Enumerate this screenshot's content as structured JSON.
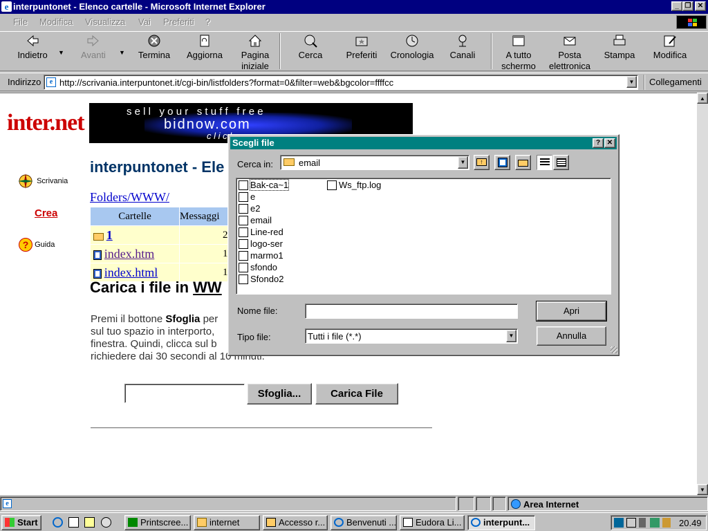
{
  "window": {
    "title": "interpuntonet - Elenco cartelle - Microsoft Internet Explorer"
  },
  "menu": [
    "File",
    "Modifica",
    "Visualizza",
    "Vai",
    "Preferiti",
    "?"
  ],
  "toolbar": {
    "back": "Indietro",
    "forward": "Avanti",
    "stop": "Termina",
    "refresh": "Aggiorna",
    "home_1": "Pagina",
    "home_2": "iniziale",
    "search": "Cerca",
    "favorites": "Preferiti",
    "history": "Cronologia",
    "channels": "Canali",
    "fullscreen_1": "A tutto",
    "fullscreen_2": "schermo",
    "mail_1": "Posta",
    "mail_2": "elettronica",
    "print": "Stampa",
    "edit": "Modifica"
  },
  "address": {
    "label": "Indirizzo",
    "url": "http://scrivania.interpuntonet.it/cgi-bin/listfolders?format=0&filter=web&bgcolor=ffffcc",
    "links": "Collegamenti"
  },
  "page": {
    "logo": "inter.net",
    "banner_line1": "s e l l   y o u r   s t u f f   f r e e",
    "banner_line2": "bidnow.com",
    "banner_line3": "c l i c k",
    "heading": "interpuntonet - Ele",
    "nav": {
      "scrivania": "Scrivania",
      "crea": "Crea",
      "guida": "Guida"
    },
    "path": "Folders/WWW/",
    "table": {
      "headers": [
        "Cartelle",
        "Messaggi"
      ],
      "rows": [
        {
          "name": "1",
          "count": "2"
        },
        {
          "name": "index.htm",
          "count": "1"
        },
        {
          "name": "index.html",
          "count": "1"
        }
      ]
    },
    "upload_heading_prefix": "Carica i file in ",
    "upload_heading_link": "WW",
    "para1_a": "Premi il bottone ",
    "para1_b": "Sfoglia",
    "para1_c": " per",
    "para2": "sul tuo spazio in interporto,",
    "para3": "finestra. Quindi, clicca sul b",
    "para4": "richiedere dai 30 secondi al 10 minuti.",
    "browse_button": "Sfoglia...",
    "upload_button": "Carica File"
  },
  "dialog": {
    "title": "Scegli file",
    "look_in_label": "Cerca in:",
    "look_in_value": "email",
    "files_col1": [
      "Bak-ca~1",
      "e",
      "e2",
      "email",
      "Line-red",
      "logo-ser",
      "marmo1",
      "sfondo",
      "Sfondo2"
    ],
    "files_col2": [
      "Ws_ftp.log"
    ],
    "filename_label": "Nome file:",
    "filename_value": "",
    "filetype_label": "Tipo file:",
    "filetype_value": "Tutti i file (*.*)",
    "open_button": "Apri",
    "cancel_button": "Annulla"
  },
  "status": {
    "zone": "Area Internet"
  },
  "taskbar": {
    "start": "Start",
    "tasks": [
      "Printscree...",
      "internet",
      "Accesso r...",
      "Benvenuti ...",
      "Eudora Li...",
      "interpunt..."
    ],
    "clock": "20.49"
  }
}
